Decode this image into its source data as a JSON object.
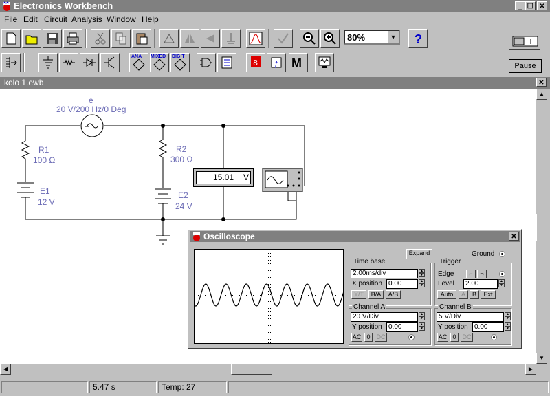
{
  "app": {
    "title": "Electronics Workbench"
  },
  "menu": [
    "File",
    "Edit",
    "Circuit",
    "Analysis",
    "Window",
    "Help"
  ],
  "zoom": {
    "value": "80%"
  },
  "toolbar": {
    "pause_label": "Pause",
    "ana_label": "ANA",
    "mixed_label": "MIXED",
    "digit_label": "DIGIT",
    "m_label": "M",
    "f_label": "f",
    "help_label": "?"
  },
  "document": {
    "title": "kolo 1.ewb"
  },
  "circuit": {
    "source_name": "e",
    "source_value": "20 V/200 Hz/0 Deg",
    "r1_name": "R1",
    "r1_value": "100 Ω",
    "r2_name": "R2",
    "r2_value": "300 Ω",
    "e1_name": "E1",
    "e1_value": "12 V",
    "e2_name": "E2",
    "e2_value": "24 V",
    "voltmeter_reading": "15.01",
    "voltmeter_unit": "V"
  },
  "oscilloscope": {
    "title": "Oscilloscope",
    "expand_label": "Expand",
    "ground_label": "Ground",
    "timebase_label": "Time base",
    "timebase_value": "2.00ms/div",
    "xpos_label": "X position",
    "xpos_value": "0.00",
    "mode_yt": "Y/T",
    "mode_ba": "B/A",
    "mode_ab": "A/B",
    "trigger_label": "Trigger",
    "edge_label": "Edge",
    "level_label": "Level",
    "level_value": "2.00",
    "auto_label": "Auto",
    "a_label": "A",
    "b_label": "B",
    "ext_label": "Ext",
    "channel_a_label": "Channel A",
    "channel_a_scale": "20  V/Div",
    "ypos_a_label": "Y position",
    "ypos_a_value": "0.00",
    "channel_b_label": "Channel B",
    "channel_b_scale": "5  V/Div",
    "ypos_b_label": "Y position",
    "ypos_b_value": "0.00",
    "ac": "AC",
    "zero": "0",
    "dc": "DC"
  },
  "status": {
    "time": "5.47 s",
    "temp": "Temp:  27"
  }
}
